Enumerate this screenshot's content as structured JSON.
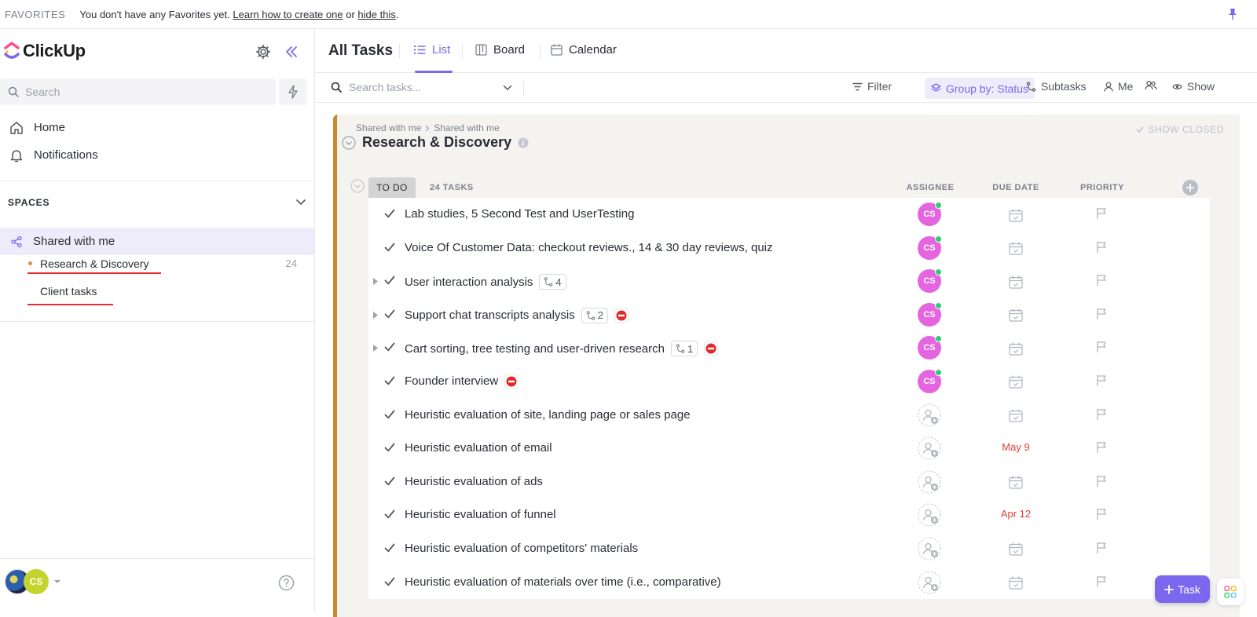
{
  "favorites": {
    "title": "FAVORITES",
    "message": "You don't have any Favorites yet.",
    "learn_link": "Learn how to create one",
    "or": "or",
    "hide_link": "hide this",
    "period": "."
  },
  "sidebar": {
    "app_name": "ClickUp",
    "search_placeholder": "Search",
    "nav": [
      {
        "label": "Home",
        "icon": "home-icon"
      },
      {
        "label": "Notifications",
        "icon": "bell-icon"
      }
    ],
    "spaces_title": "SPACES",
    "space": {
      "label": "Shared with me",
      "icon": "share-icon"
    },
    "lists": [
      {
        "label": "Research & Discovery",
        "count": "24",
        "has_dot": true
      },
      {
        "label": "Client tasks",
        "count": "",
        "has_dot": false
      }
    ],
    "user_initials": "CS"
  },
  "main": {
    "page_title": "All Tasks",
    "tabs": [
      {
        "label": "List",
        "active": true
      },
      {
        "label": "Board",
        "active": false
      },
      {
        "label": "Calendar",
        "active": false
      }
    ],
    "toolbar": {
      "search_placeholder": "Search tasks...",
      "filter": "Filter",
      "group_by": "Group by: Status",
      "subtasks": "Subtasks",
      "me": "Me",
      "show": "Show"
    },
    "panel": {
      "crumb_1": "Shared with me",
      "crumb_2": "Shared with me",
      "title": "Research & Discovery",
      "show_closed": "SHOW CLOSED",
      "status": "TO DO",
      "task_count": "24 TASKS",
      "columns": {
        "assignee": "ASSIGNEE",
        "due": "DUE DATE",
        "priority": "PRIORITY"
      }
    },
    "tasks": [
      {
        "name": "Lab studies, 5 Second Test and UserTesting",
        "assignee": "CS",
        "due": "",
        "subtasks": "",
        "blocked": false,
        "expandable": false
      },
      {
        "name": "Voice Of Customer Data: checkout reviews., 14 & 30 day reviews, quiz",
        "assignee": "CS",
        "due": "",
        "subtasks": "",
        "blocked": false,
        "expandable": false
      },
      {
        "name": "User interaction analysis",
        "assignee": "CS",
        "due": "",
        "subtasks": "4",
        "blocked": false,
        "expandable": true
      },
      {
        "name": "Support chat transcripts analysis",
        "assignee": "CS",
        "due": "",
        "subtasks": "2",
        "blocked": true,
        "expandable": true
      },
      {
        "name": "Cart sorting, tree testing and user-driven research",
        "assignee": "CS",
        "due": "",
        "subtasks": "1",
        "blocked": true,
        "expandable": true
      },
      {
        "name": "Founder interview",
        "assignee": "CS",
        "due": "",
        "subtasks": "",
        "blocked": true,
        "expandable": false
      },
      {
        "name": "Heuristic evaluation of site, landing page or sales page",
        "assignee": "",
        "due": "",
        "subtasks": "",
        "blocked": false,
        "expandable": false
      },
      {
        "name": "Heuristic evaluation of email",
        "assignee": "",
        "due": "May 9",
        "subtasks": "",
        "blocked": false,
        "expandable": false
      },
      {
        "name": "Heuristic evaluation of ads",
        "assignee": "",
        "due": "",
        "subtasks": "",
        "blocked": false,
        "expandable": false
      },
      {
        "name": "Heuristic evaluation of funnel",
        "assignee": "",
        "due": "Apr 12",
        "subtasks": "",
        "blocked": false,
        "expandable": false
      },
      {
        "name": "Heuristic evaluation of competitors' materials",
        "assignee": "",
        "due": "",
        "subtasks": "",
        "blocked": false,
        "expandable": false
      },
      {
        "name": "Heuristic evaluation of materials over time (i.e., comparative)",
        "assignee": "",
        "due": "",
        "subtasks": "",
        "blocked": false,
        "expandable": false
      }
    ],
    "fab_label": "Task"
  },
  "colors": {
    "accent": "#7b68ee",
    "space_bar": "#c88a2e",
    "avatar_cs": "#e565e0",
    "overdue": "#e03b3b",
    "annotation_red": "#e52b2b"
  }
}
